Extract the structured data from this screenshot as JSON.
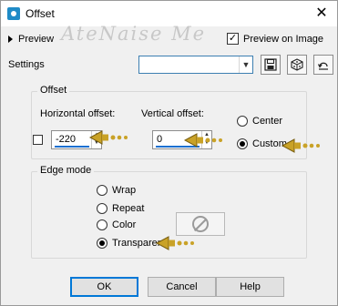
{
  "window": {
    "title": "Offset"
  },
  "watermark": {
    "text": "AteNaise Me"
  },
  "preview": {
    "toggle_label": "Preview",
    "on_image_label": "Preview on Image",
    "on_image_checked": true
  },
  "settings": {
    "label": "Settings",
    "value": ""
  },
  "offset_group": {
    "title": "Offset",
    "horizontal_label": "Horizontal offset:",
    "horizontal_value": "-220",
    "vertical_label": "Vertical offset:",
    "vertical_value": "0",
    "center_label": "Center",
    "custom_label": "Custom",
    "selected": "Custom"
  },
  "edge_group": {
    "title": "Edge mode",
    "options": [
      "Wrap",
      "Repeat",
      "Color",
      "Transparent"
    ],
    "selected": "Transparent"
  },
  "buttons": {
    "ok": "OK",
    "cancel": "Cancel",
    "help": "Help"
  },
  "colors": {
    "pointer": "#c9a227",
    "focus": "#1a6fd1"
  }
}
